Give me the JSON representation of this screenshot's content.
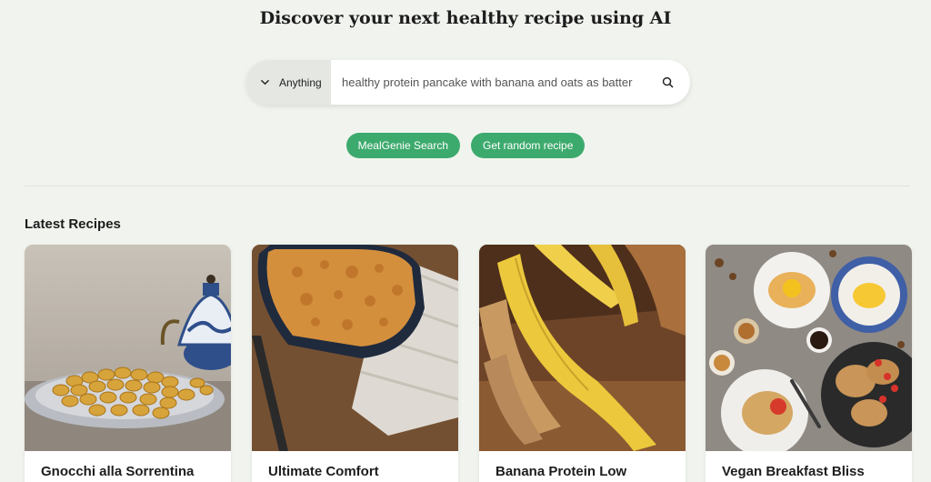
{
  "hero": {
    "title_prefix": "Discover your next ",
    "title_emphasis": "healthy",
    "title_suffix": " recipe using AI"
  },
  "search": {
    "category": "Anything",
    "value": "healthy protein pancake with banana and oats as batter",
    "icons": {
      "dropdown": "chevron-down-icon",
      "submit": "search-icon"
    }
  },
  "actions": {
    "mealgenie": "MealGenie Search",
    "random": "Get random recipe"
  },
  "colors": {
    "background": "#f1f4ee",
    "accent": "#3daa6d"
  },
  "latest": {
    "heading": "Latest Recipes",
    "recipes": [
      {
        "title": "Gnocchi alla Sorrentina"
      },
      {
        "title": "Ultimate Comfort"
      },
      {
        "title": "Banana Protein Low"
      },
      {
        "title": "Vegan Breakfast Bliss"
      }
    ]
  }
}
